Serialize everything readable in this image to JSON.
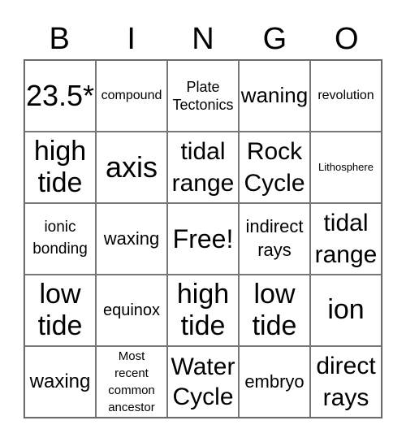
{
  "header": [
    "B",
    "I",
    "N",
    "G",
    "O"
  ],
  "cells": [
    "23.5*",
    "compound",
    "Plate Tectonics",
    "waning",
    "revolution",
    "high tide",
    "axis",
    "tidal range",
    "Rock Cycle",
    "Lithosphere",
    "ionic bonding",
    "waxing",
    "Free!",
    "indirect rays",
    "tidal range",
    "low tide",
    "equinox",
    "high tide",
    "low tide",
    "ion",
    "waxing",
    "Most recent common ancestor",
    "Water Cycle",
    "embryo",
    "direct rays"
  ]
}
